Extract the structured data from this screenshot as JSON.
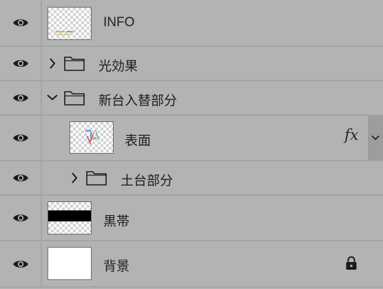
{
  "layers": [
    {
      "name": "INFO",
      "kind": "layer",
      "thumbnail": "transparent-with-text",
      "visible": true
    },
    {
      "name": "光効果",
      "kind": "group",
      "expanded": false,
      "visible": true
    },
    {
      "name": "新台入替部分",
      "kind": "group",
      "expanded": true,
      "visible": true
    },
    {
      "name": "表面",
      "kind": "layer",
      "thumbnail": "transparent-with-art",
      "visible": true,
      "effects": "fx"
    },
    {
      "name": "土台部分",
      "kind": "group",
      "expanded": false,
      "visible": true
    },
    {
      "name": "黒帯",
      "kind": "layer",
      "thumbnail": "black-band",
      "visible": true
    },
    {
      "name": "背景",
      "kind": "layer",
      "thumbnail": "white",
      "visible": true,
      "locked": true
    }
  ],
  "icons": {
    "visibility": "eye-icon",
    "collapsed": "chevron-right-icon",
    "expanded": "chevron-down-icon",
    "group": "folder-icon",
    "effects_menu": "chevron-down-icon",
    "lock": "lock-icon"
  },
  "colors": {
    "panel_bg": "#b3b3b3",
    "divider": "#a4a4a4",
    "text": "#1e1e1e",
    "icon": "#1a1a1a"
  }
}
